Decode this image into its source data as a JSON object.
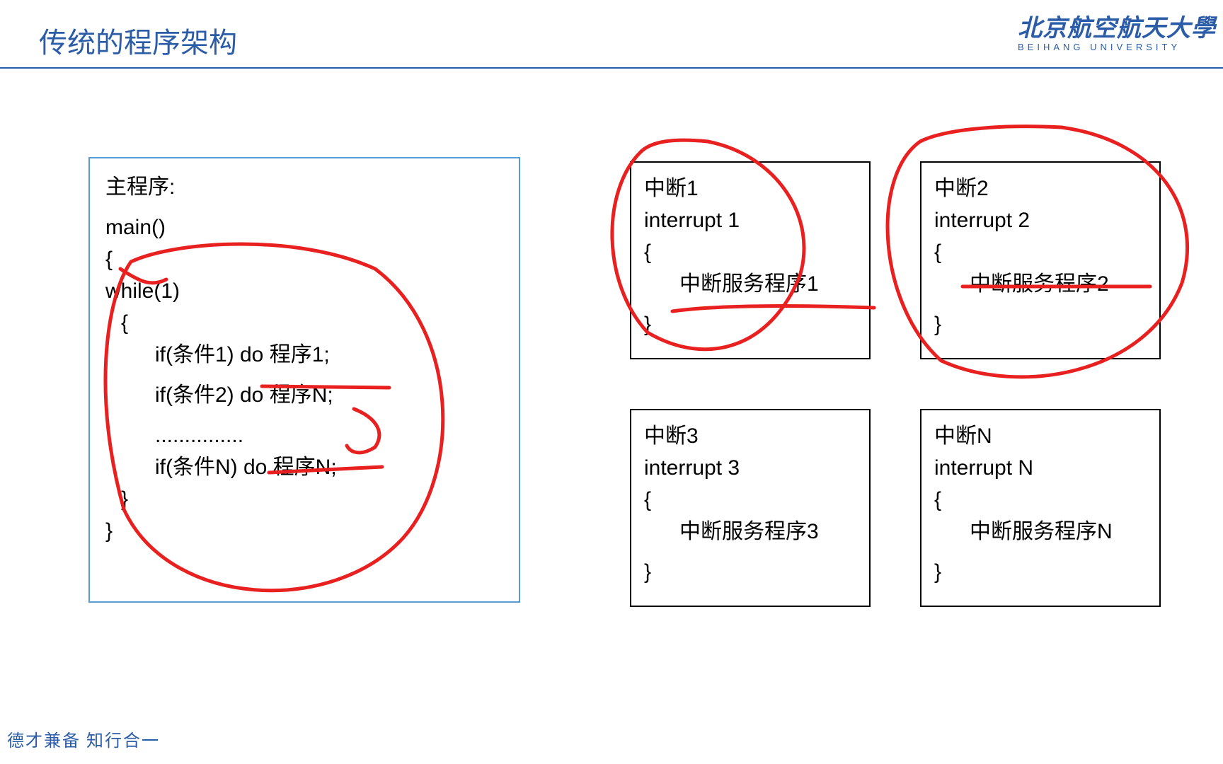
{
  "header": {
    "title": "传统的程序架构",
    "logo_cn": "北京航空航天大學",
    "logo_en": "BEIHANG UNIVERSITY"
  },
  "main": {
    "label": "主程序:",
    "func": "main()",
    "open": "{",
    "while": "while(1)",
    "wopen": "{",
    "if1": "if(条件1)  do  程序1;",
    "if2": "if(条件2)  do  程序N;",
    "dots": "...............",
    "ifN": "if(条件N)  do  程序N;",
    "wclose": "}",
    "close": "}"
  },
  "interrupts": [
    {
      "title": "中断1",
      "sig": "interrupt 1",
      "open": "{",
      "body": "中断服务程序1",
      "close": "}"
    },
    {
      "title": "中断2",
      "sig": "interrupt 2",
      "open": "{",
      "body": "中断服务程序2",
      "close": "}"
    },
    {
      "title": "中断3",
      "sig": "interrupt 3",
      "open": "{",
      "body": "中断服务程序3",
      "close": "}"
    },
    {
      "title": "中断N",
      "sig": "interrupt N",
      "open": "{",
      "body": "中断服务程序N",
      "close": "}"
    }
  ],
  "footer": "德才兼备 知行合一"
}
